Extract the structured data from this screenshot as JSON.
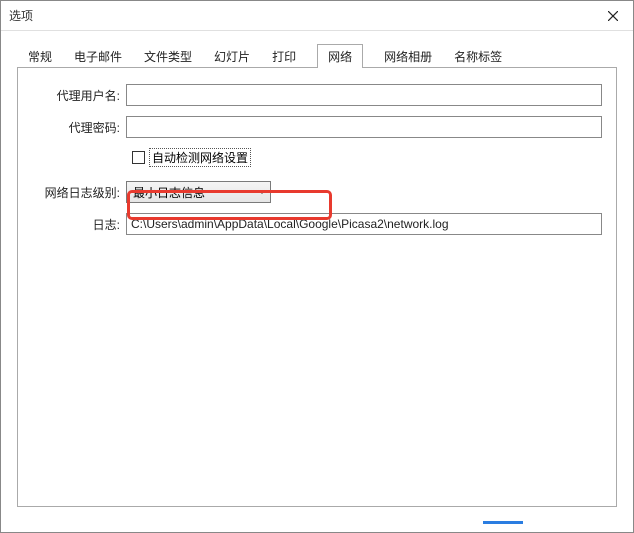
{
  "window": {
    "title": "选项"
  },
  "tabs": {
    "t0": "常规",
    "t1": "电子邮件",
    "t2": "文件类型",
    "t3": "幻灯片",
    "t4": "打印",
    "t5": "网络",
    "t6": "网络相册",
    "t7": "名称标签"
  },
  "form": {
    "proxy_user_label": "代理用户名:",
    "proxy_user_value": "",
    "proxy_pass_label": "代理密码:",
    "proxy_pass_value": "",
    "autodetect_label": "自动检测网络设置",
    "loglevel_label": "网络日志级别:",
    "loglevel_value": "最小日志信息",
    "log_label": "日志:",
    "log_value": "C:\\Users\\admin\\AppData\\Local\\Google\\Picasa2\\network.log"
  }
}
